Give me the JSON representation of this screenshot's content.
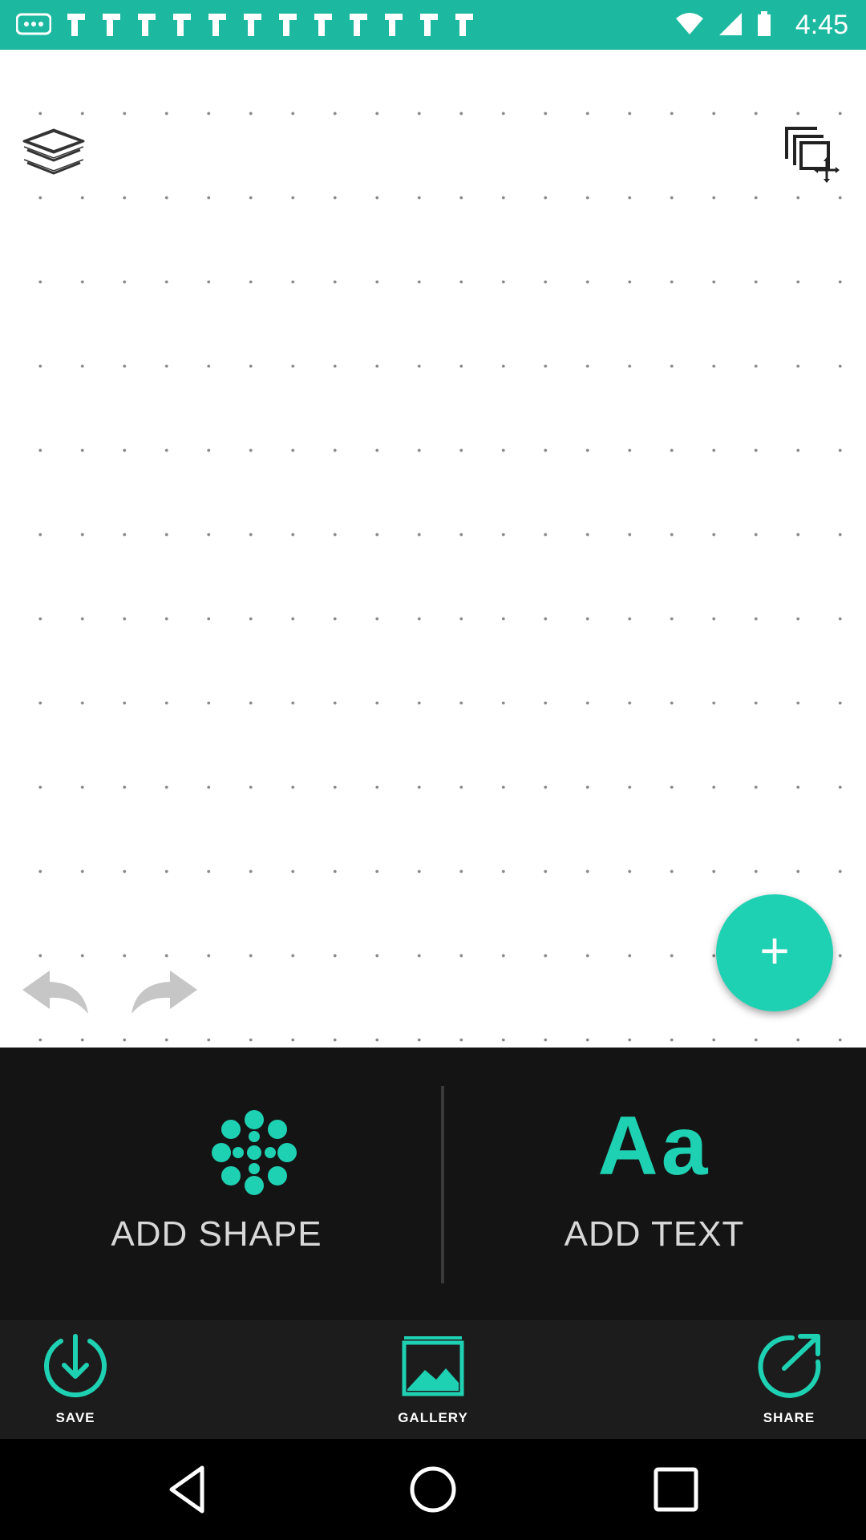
{
  "status_bar": {
    "time": "4:45",
    "left_icons": [
      "more-icon",
      "notification-icon",
      "notification-icon",
      "notification-icon",
      "notification-icon",
      "notification-icon",
      "notification-icon",
      "notification-icon",
      "notification-icon",
      "notification-icon",
      "notification-icon",
      "notification-icon",
      "notification-icon",
      "notification-icon"
    ],
    "right_icons": [
      "wifi-icon",
      "signal-icon",
      "battery-icon"
    ],
    "background": "#1db8a0"
  },
  "canvas": {
    "background": "#ffffff",
    "dot_grid": true,
    "icons": {
      "layers": "layers-icon",
      "move": "move-layers-icon",
      "undo": "undo-icon",
      "redo": "redo-icon",
      "fab": "plus-icon"
    }
  },
  "add_panel": {
    "shape": {
      "label": "ADD SHAPE",
      "icon": "shape-flower-icon"
    },
    "text": {
      "label": "ADD TEXT",
      "icon_text": "Aa"
    }
  },
  "toolbar": {
    "save": {
      "label": "SAVE",
      "icon": "download-icon"
    },
    "gallery": {
      "label": "GALLERY",
      "icon": "image-icon"
    },
    "share": {
      "label": "SHARE",
      "icon": "share-arrow-icon"
    }
  },
  "colors": {
    "accent": "#1fd1b3",
    "panel": "#141414",
    "toolbar": "#1c1c1c",
    "status_bar": "#1db8a0"
  }
}
